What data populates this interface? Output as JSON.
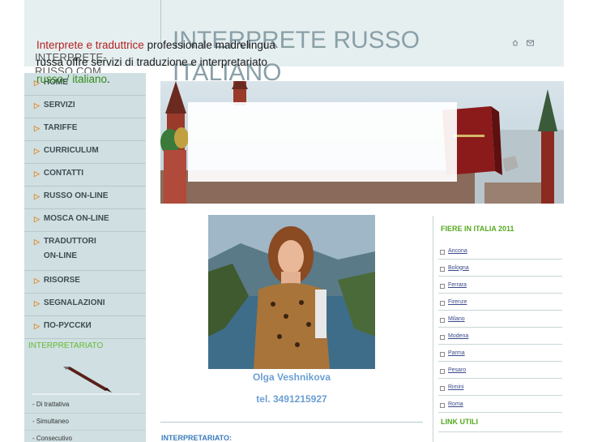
{
  "header": {
    "site_name": "INTERPRETE-RUSSO.COM",
    "title": "INTERPRETE RUSSO ITALIANO",
    "icons": [
      "home-icon",
      "mail-icon"
    ]
  },
  "sidebar": {
    "items": [
      {
        "label": "HOME"
      },
      {
        "label": "SERVIZI"
      },
      {
        "label": "TARIFFE"
      },
      {
        "label": "CURRICULUM"
      },
      {
        "label": "CONTATTI"
      },
      {
        "label": "RUSSO ON-LINE"
      },
      {
        "label": "MOSCA ON-LINE"
      },
      {
        "label": "TRADUTTORI ON-LINE"
      },
      {
        "label": "RISORSE"
      },
      {
        "label": "SEGNALAZIONI"
      },
      {
        "label": "ПО-РУССКИ"
      }
    ],
    "interp_heading": "INTERPRETARIATO",
    "sub_links": [
      "- Di trattativa",
      "- Simultaneo",
      "- Consecutivo"
    ]
  },
  "banner": {
    "text_red": "Interprete e traduttrice",
    "text_main": " professionale madrelingua russa offre servizi di traduzione e interpretariato",
    "text_green": "russo / italiano",
    "text_end": "."
  },
  "profile": {
    "name": "Olga Veshnikova",
    "tel": "tel. 3491215927"
  },
  "content": {
    "heading": "INTERPRETARIATO:"
  },
  "right": {
    "fairs_heading": "FIERE IN ITALIA 2011",
    "fairs": [
      "Ancona",
      "Bologna",
      "Ferrara",
      "Firenze",
      "Milano",
      "Modena",
      "Parma",
      "Pesaro",
      "Rimini",
      "Roma"
    ],
    "links_heading": "LINK UTILI"
  },
  "colors": {
    "accent_orange": "#e2892a",
    "green": "#55aa22",
    "blue_text": "#6b9fd4",
    "sidebar_bg": "#cfdfe2"
  }
}
